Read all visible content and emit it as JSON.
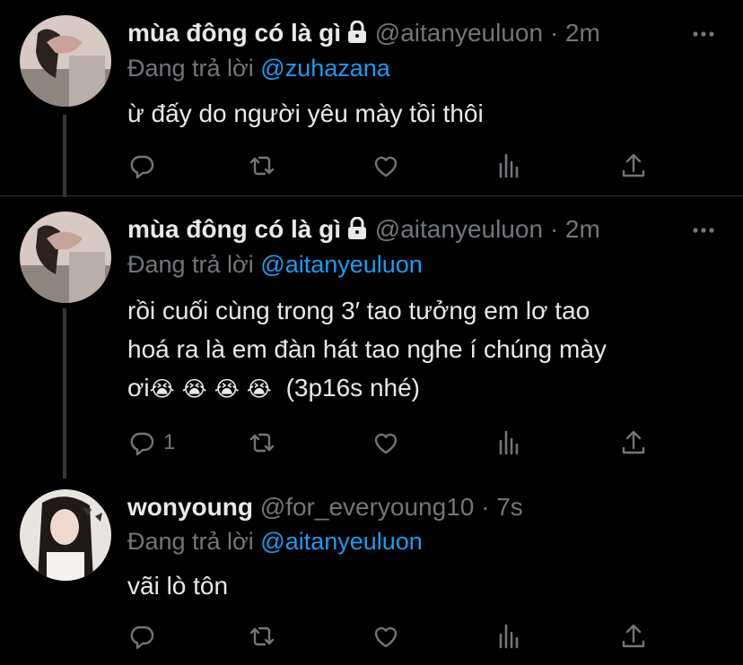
{
  "tweets": [
    {
      "name": "mùa đông có là gì",
      "handle": "@aitanyeuluon",
      "sep": "·",
      "time": "2m",
      "replying_prefix": "Đang trả lời",
      "replying_to": "@zuhazana",
      "text": "ừ đấy do người yêu mày tồi thôi",
      "reply_count": "",
      "locked": true
    },
    {
      "name": "mùa đông có là gì",
      "handle": "@aitanyeuluon",
      "sep": "·",
      "time": "2m",
      "replying_prefix": "Đang trả lời",
      "replying_to": "@aitanyeuluon",
      "text_line1": "rồi cuối cùng trong 3′ tao tưởng em lơ tao",
      "text_line2": "hoá ra là em đàn hát tao nghe í chúng mày",
      "text_line3_prefix": "ơi",
      "emoji": "😭",
      "text_line3_suffix": "(3p16s nhé)",
      "reply_count": "1",
      "locked": true
    },
    {
      "name": "wonyoung",
      "handle": "@for_everyoung10",
      "sep": "·",
      "time": "7s",
      "replying_prefix": "Đang trả lời",
      "replying_to": "@aitanyeuluon",
      "text": "vãi lò tôn",
      "reply_count": "",
      "locked": false
    }
  ],
  "icons": {
    "reply": "reply-icon",
    "retweet": "retweet-icon",
    "like": "like-icon",
    "analytics": "analytics-icon",
    "share": "share-icon",
    "more": "more-icon",
    "lock": "lock-icon"
  },
  "colors": {
    "background": "#000000",
    "text": "#e7e9ea",
    "muted": "#71767b",
    "link": "#1d9bf0",
    "divider": "#2f3336"
  }
}
